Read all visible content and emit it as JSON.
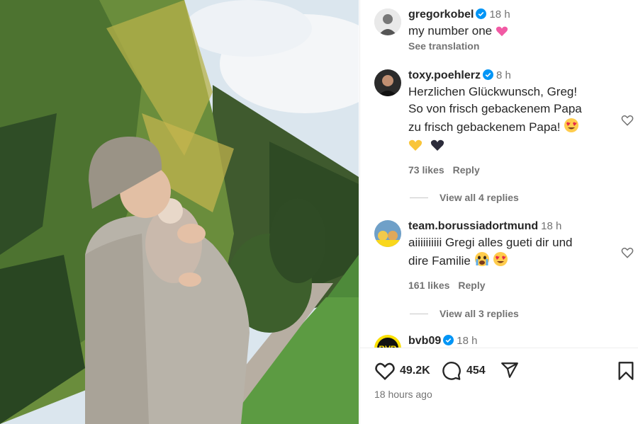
{
  "post": {
    "author": "gregorkobel",
    "time": "18 h",
    "caption": "my number one",
    "see_translation": "See translation"
  },
  "comments": [
    {
      "user": "toxy.poehlerz",
      "time": "8 h",
      "lines": [
        "Herzlichen Glückwunsch, Greg!",
        "So von frisch gebackenem Papa",
        "zu frisch gebackenem Papa!"
      ],
      "likes": "73 likes",
      "reply": "Reply",
      "view_replies": "View all 4 replies"
    },
    {
      "user": "team.borussiadortmund",
      "time": "18 h",
      "lines": [
        "aiiiiiiiiii Gregi alles gueti dir und",
        "dire Familie"
      ],
      "likes": "161 likes",
      "reply": "Reply",
      "view_replies": "View all 3 replies"
    },
    {
      "user": "bvb09",
      "time": "18 h"
    }
  ],
  "actions": {
    "like_count": "49.2K",
    "comment_count": "454",
    "posted": "18 hours ago"
  },
  "icons": {
    "like": "heart-icon",
    "comment": "comment-icon",
    "share": "send-icon",
    "save": "bookmark-icon",
    "verified": "verified-badge-icon"
  },
  "colors": {
    "verified": "#0095f6",
    "secondary_text": "#737373",
    "primary_text": "#262626"
  }
}
